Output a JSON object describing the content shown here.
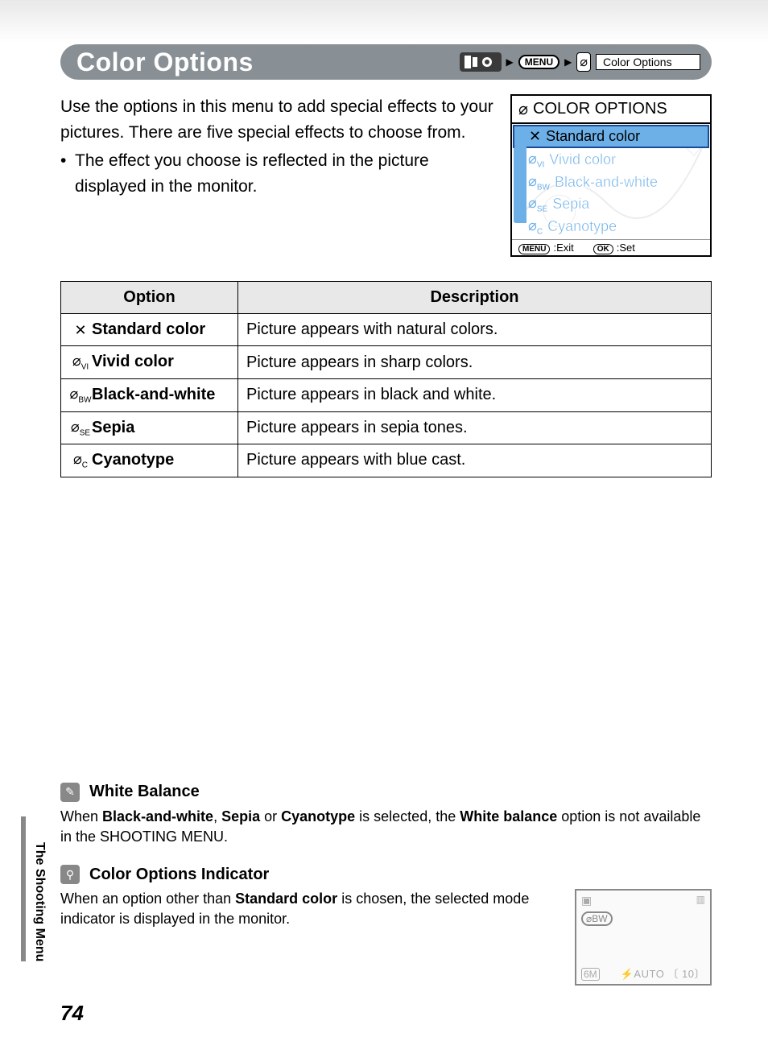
{
  "section_title": "Color Options",
  "breadcrumb": {
    "menu_label": "MENU",
    "final_label": "Color Options"
  },
  "intro": {
    "p1": "Use the options in this menu to add special effects to your pictures. There are five special effects to choose from.",
    "bullet1": "The effect you choose is reflected in the picture displayed in the monitor."
  },
  "lcd": {
    "title": "COLOR OPTIONS",
    "items": [
      {
        "label": "Standard color",
        "icon": "std"
      },
      {
        "label": "Vivid color",
        "icon": "VI"
      },
      {
        "label": "Black-and-white",
        "icon": "BW"
      },
      {
        "label": "Sepia",
        "icon": "SE"
      },
      {
        "label": "Cyanotype",
        "icon": "C"
      }
    ],
    "footer_exit": ":Exit",
    "footer_set": ":Set",
    "menu_key": "MENU",
    "ok_key": "OK"
  },
  "table": {
    "headers": {
      "option": "Option",
      "description": "Description"
    },
    "rows": [
      {
        "option": "Standard color",
        "iconSub": "",
        "description": "Picture appears with natural colors."
      },
      {
        "option": "Vivid color",
        "iconSub": "VI",
        "description": "Picture appears in sharp colors."
      },
      {
        "option": "Black-and-white",
        "iconSub": "BW",
        "description": "Picture appears in black and white."
      },
      {
        "option": "Sepia",
        "iconSub": "SE",
        "description": "Picture appears in sepia tones."
      },
      {
        "option": "Cyanotype",
        "iconSub": "C",
        "description": "Picture appears with blue cast."
      }
    ]
  },
  "notes": {
    "wb_title": "White Balance",
    "wb_pre": "When ",
    "wb_b1": "Black-and-white",
    "wb_sep1": ", ",
    "wb_b2": "Sepia",
    "wb_sep2": " or ",
    "wb_b3": "Cyanotype",
    "wb_mid": " is selected, the ",
    "wb_b4": "White balance",
    "wb_post": " option is not available in the SHOOTING MENU.",
    "coi_title": "Color Options Indicator",
    "coi_pre": "When an option other than ",
    "coi_b1": "Standard color",
    "coi_post": " is chosen, the selected mode indicator is displayed in the monitor."
  },
  "mini_lcd": {
    "ind": "⌀BW",
    "bl": "6M",
    "br": "⚡AUTO 〔 10〕"
  },
  "side_label": "The Shooting Menu",
  "page_number": "74"
}
